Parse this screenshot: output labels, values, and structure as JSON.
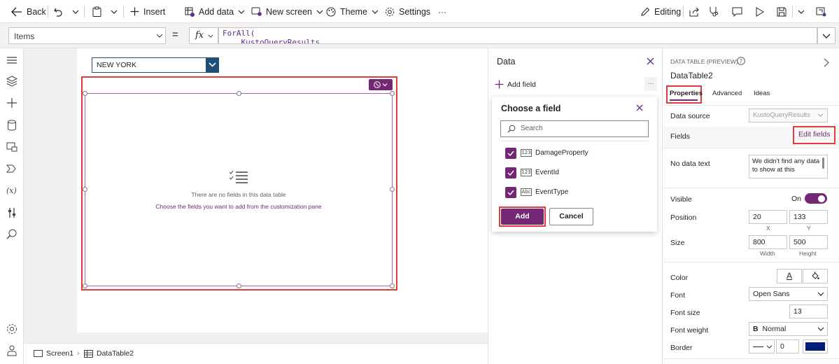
{
  "toolbar": {
    "back": "Back",
    "insert": "Insert",
    "add_data": "Add data",
    "new_screen": "New screen",
    "theme": "Theme",
    "settings": "Settings",
    "more": "···",
    "editing": "Editing"
  },
  "formula_bar": {
    "property": "Items",
    "equals": "=",
    "fx": "fx",
    "line1": "ForAll(",
    "line2": "    KustoQueryResults"
  },
  "canvas": {
    "dropdown_value": "NEW YORK",
    "empty_title": "There are no fields in this data table",
    "empty_hint": "Choose the fields you want to add from the customization pane"
  },
  "statusbar": {
    "screen": "Screen1",
    "datatable": "DataTable2"
  },
  "data_pane": {
    "title": "Data",
    "add_field": "Add field",
    "more": "···",
    "choose_title": "Choose a field",
    "search_placeholder": "Search",
    "fields": [
      {
        "name": "DamageProperty",
        "type": "123",
        "checked": true
      },
      {
        "name": "EventId",
        "type": "123",
        "checked": true
      },
      {
        "name": "EventType",
        "type": "Abc",
        "checked": true
      }
    ],
    "add_btn": "Add",
    "cancel_btn": "Cancel"
  },
  "props": {
    "type_label": "DATA TABLE (PREVIEW)",
    "name": "DataTable2",
    "tabs": [
      "Properties",
      "Advanced",
      "Ideas"
    ],
    "data_source_label": "Data source",
    "data_source_value": "KustoQueryResults",
    "fields_label": "Fields",
    "edit_fields": "Edit fields",
    "no_data_label": "No data text",
    "no_data_value": "We didn't find any data to show at this",
    "visible_label": "Visible",
    "visible_value": "On",
    "position_label": "Position",
    "pos_x": "20",
    "pos_y": "133",
    "x_label": "X",
    "y_label": "Y",
    "size_label": "Size",
    "width": "800",
    "height": "500",
    "width_label": "Width",
    "height_label": "Height",
    "color_label": "Color",
    "color_glyph": "A",
    "font_label": "Font",
    "font_value": "Open Sans",
    "font_size_label": "Font size",
    "font_size_value": "13",
    "font_weight_label": "Font weight",
    "font_weight_glyph": "B",
    "font_weight_value": "Normal",
    "border_label": "Border",
    "border_width": "0",
    "border_color": "#001b7a"
  },
  "colors": {
    "accent": "#742774",
    "highlight": "#e23b3b"
  }
}
